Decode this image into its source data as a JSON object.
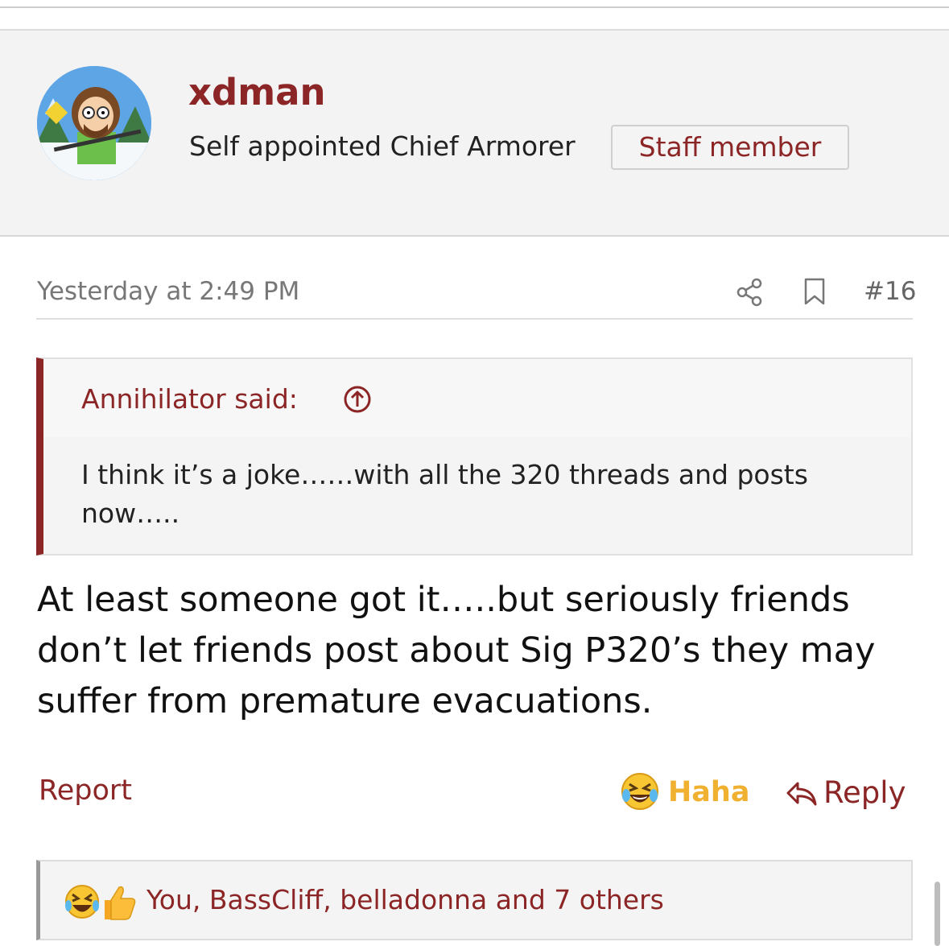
{
  "user": {
    "name": "xdman",
    "title": "Self appointed Chief Armorer",
    "badge": "Staff member"
  },
  "post": {
    "date": "Yesterday at 2:49 PM",
    "number": "#16",
    "icons": [
      "share-icon",
      "bookmark-icon"
    ]
  },
  "quote": {
    "author": "Annihilator said:",
    "body": "I think it’s a joke……with all the 320 threads and posts now….."
  },
  "message": {
    "text": "At least someone got it…..but seriously friends don’t let friends post about Sig P320’s they may suffer from premature evacuations."
  },
  "actions": {
    "report": "Report",
    "haha": "Haha",
    "reply": "Reply"
  },
  "reactions": {
    "users": "You, BassCliff, belladonna and 7 others",
    "icons": [
      "laughing-emoji-icon",
      "thumbs-up-icon"
    ]
  },
  "colors": {
    "accent": "#8c2626",
    "haha": "#f0b030",
    "muted": "#777777"
  }
}
